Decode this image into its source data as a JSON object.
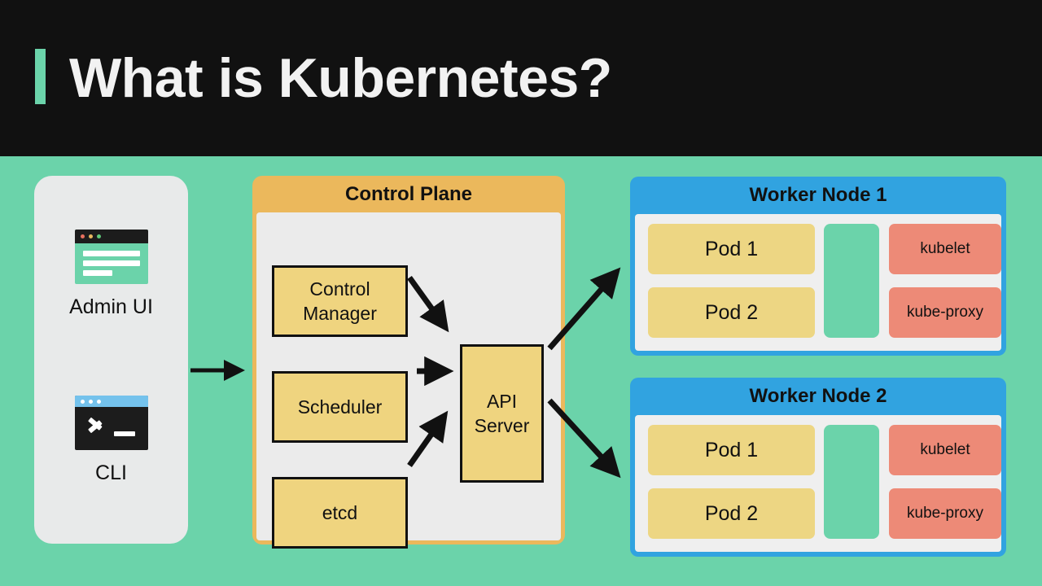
{
  "slide": {
    "title": "What is Kubernetes?",
    "accent_color": "#6BD3AA",
    "header_bg": "#111111",
    "background": "#6BD3AA"
  },
  "clients": {
    "panel_bg": "#E8EAEA",
    "items": [
      {
        "label": "Admin UI",
        "icon": "browser-window-icon"
      },
      {
        "label": "CLI",
        "icon": "terminal-icon"
      }
    ]
  },
  "control_plane": {
    "title": "Control Plane",
    "header_color": "#EBB85C",
    "body_color": "#EBEBEB",
    "box_color": "#EFD47F",
    "components": [
      {
        "id": "control-manager",
        "label": "Control Manager"
      },
      {
        "id": "scheduler",
        "label": "Scheduler"
      },
      {
        "id": "etcd",
        "label": "etcd"
      }
    ],
    "api_server": {
      "label": "API Server"
    }
  },
  "worker_nodes": [
    {
      "title": "Worker Node 1",
      "pods": [
        {
          "label": "Pod 1"
        },
        {
          "label": "Pod 2"
        }
      ],
      "agents": [
        {
          "label": "kubelet"
        },
        {
          "label": "kube-proxy"
        }
      ]
    },
    {
      "title": "Worker Node 2",
      "pods": [
        {
          "label": "Pod 1"
        },
        {
          "label": "Pod 2"
        }
      ],
      "agents": [
        {
          "label": "kubelet"
        },
        {
          "label": "kube-proxy"
        }
      ]
    }
  ],
  "colors": {
    "node_header": "#31A3E0",
    "pod": "#EDD683",
    "agent": "#ED8A77",
    "spacer": "#6BD3AA",
    "arrow": "#111111"
  },
  "connections": [
    {
      "from": "clients",
      "to": "control-plane"
    },
    {
      "from": "control-manager",
      "to": "api-server"
    },
    {
      "from": "scheduler",
      "to": "api-server"
    },
    {
      "from": "etcd",
      "to": "api-server"
    },
    {
      "from": "api-server",
      "to": "worker-node-1"
    },
    {
      "from": "api-server",
      "to": "worker-node-2"
    }
  ]
}
